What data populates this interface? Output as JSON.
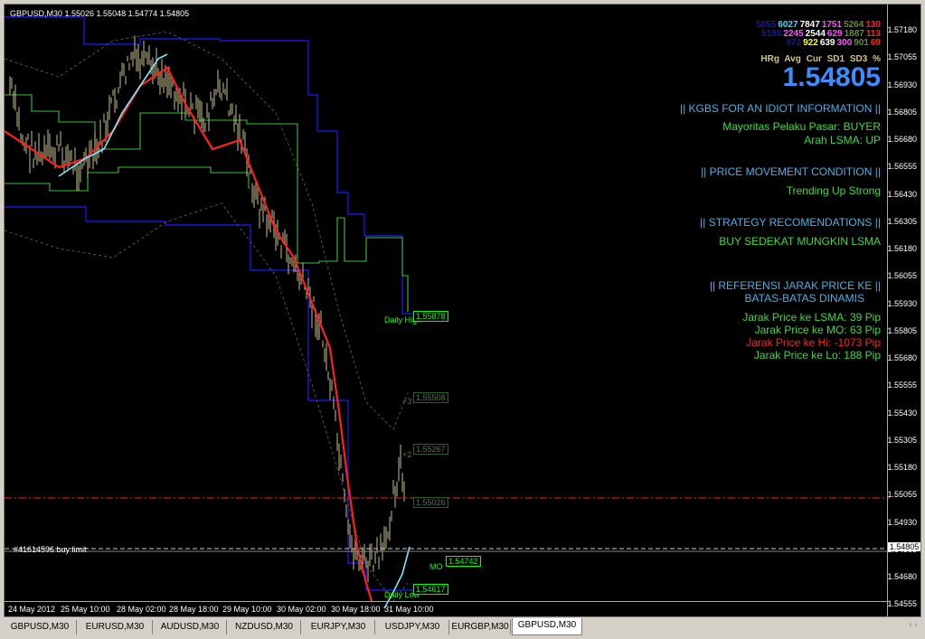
{
  "ohlc_text": "GBPUSD,M30  1.55026 1.55048 1.54774 1.54805",
  "price_axis": [
    "1.57180",
    "1.57055",
    "1.56930",
    "1.56805",
    "1.56680",
    "1.56555",
    "1.56430",
    "1.56305",
    "1.56180",
    "1.56055",
    "1.55930",
    "1.55805",
    "1.55680",
    "1.55555",
    "1.55430",
    "1.55305",
    "1.55180",
    "1.55055",
    "1.54930",
    "1.54805",
    "1.54680",
    "1.54555"
  ],
  "current_price_label": "1.54805",
  "time_axis": [
    "24 May 2012",
    "25 May 10:00",
    "28 May 02:00",
    "28 May 18:00",
    "29 May 10:00",
    "30 May 02:00",
    "30 May 18:00",
    "31 May 10:00"
  ],
  "hist_rows": [
    [
      {
        "v": "5855",
        "c": "#1a1a8c"
      },
      {
        "v": "6027",
        "c": "#55d5ff"
      },
      {
        "v": "7847",
        "c": "#ffffff"
      },
      {
        "v": "1751",
        "c": "#ff55ff"
      },
      {
        "v": "5264",
        "c": "#6a8a3a"
      },
      {
        "v": "130",
        "c": "#ff2020"
      }
    ],
    [
      {
        "v": "5198",
        "c": "#1a1a8c"
      },
      {
        "v": "2245",
        "c": "#ff55ff"
      },
      {
        "v": "2544",
        "c": "#ffffff"
      },
      {
        "v": "629",
        "c": "#ff55ff"
      },
      {
        "v": "1887",
        "c": "#6a8a3a"
      },
      {
        "v": "113",
        "c": "#ff2020"
      }
    ],
    [
      {
        "v": "872",
        "c": "#1a1a8c"
      },
      {
        "v": "922",
        "c": "#ffff00"
      },
      {
        "v": "639",
        "c": "#ffffff"
      },
      {
        "v": "300",
        "c": "#ff55ff"
      },
      {
        "v": "901",
        "c": "#6a8a3a"
      },
      {
        "v": "69",
        "c": "#ff2020"
      }
    ]
  ],
  "hist_header": "HRg Avg Cur SD1 SD3  %",
  "big_price": "1.54805",
  "info": {
    "title1": "|| KGBS FOR AN IDIOT INFORMATION ||",
    "pelaku": "Mayoritas Pelaku Pasar: BUYER",
    "arah": "Arah LSMA: UP",
    "title2": "|| PRICE MOVEMENT CONDITION ||",
    "trending": "Trending Up Strong",
    "title3": "|| STRATEGY RECOMENDATIONS ||",
    "buy": "BUY SEDEKAT MUNGKIN LSMA",
    "title4a": "|| REFERENSI JARAK PRICE KE ||",
    "title4b": "BATAS-BATAS DINAMIS",
    "lsma": "Jarak Price ke LSMA:   39 Pip",
    "mo": "Jarak Price ke MO:   63 Pip",
    "hi": "Jarak Price ke Hi:   -1073 Pip",
    "lo": "Jarak Price ke Lo:   188 Pip"
  },
  "order_label": "#41614596 buy limit",
  "labels": {
    "daily_high": "Daily High",
    "daily_high_val": "1.55878",
    "plus3": "+3",
    "plus3_val": "1.55508",
    "plus2": "+2",
    "plus2_val": "1.55267",
    "plus1_val": "1.55026",
    "mo": "MO",
    "mo_val": "1.54742",
    "daily_low": "Daily Low",
    "daily_low_val": "1.54617"
  },
  "tabs": [
    "GBPUSD,M30",
    "EURUSD,M30",
    "AUDUSD,M30",
    "NZDUSD,M30",
    "EURJPY,M30",
    "USDJPY,M30",
    "EURGBP,M30",
    "GBPUSD,M30"
  ],
  "active_tab_index": 7,
  "colors": {
    "blue_channel": "#1c1cff",
    "green_channel": "#3cbc3c",
    "lsma": "#ff2020",
    "mo": "#7fe8ff",
    "candles": "#c8c08a",
    "buy_limit_line": "#cccccc",
    "red_dash": "#ff2020"
  }
}
